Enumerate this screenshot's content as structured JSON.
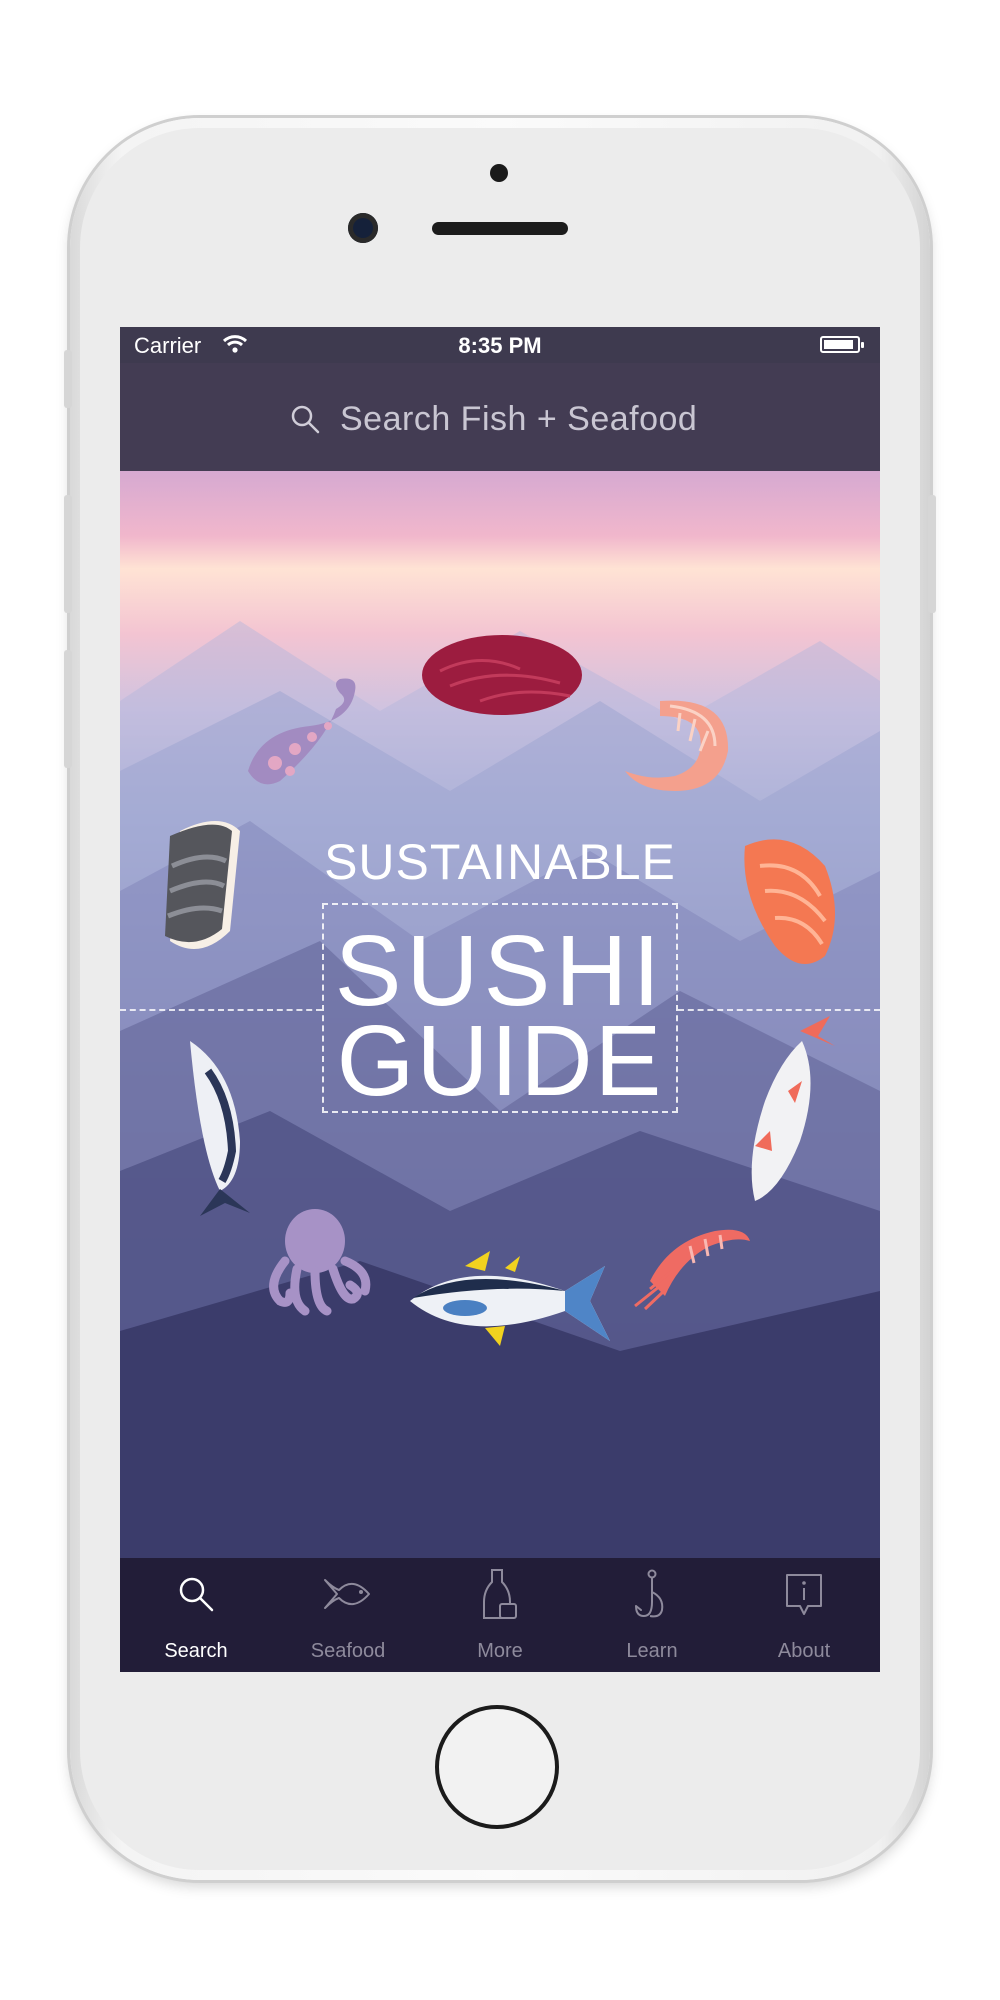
{
  "status_bar": {
    "carrier": "Carrier",
    "time": "8:35 PM"
  },
  "search": {
    "placeholder": "Search Fish + Seafood",
    "icon": "search-icon"
  },
  "hero": {
    "title_line1": "SUSTAINABLE",
    "title_line2": "SUSHI",
    "title_line3": "GUIDE",
    "illustrations": [
      "tuna-sashimi",
      "shrimp",
      "salmon-nigiri",
      "whole-fish",
      "sweet-shrimp",
      "yellowfin-tuna",
      "octopus",
      "mackerel",
      "mackerel-nigiri",
      "octopus-tentacle"
    ]
  },
  "tab_bar": {
    "tabs": [
      {
        "label": "Search",
        "icon": "search-icon",
        "active": true
      },
      {
        "label": "Seafood",
        "icon": "fish-icon",
        "active": false
      },
      {
        "label": "More",
        "icon": "sake-icon",
        "active": false
      },
      {
        "label": "Learn",
        "icon": "hook-icon",
        "active": false
      },
      {
        "label": "About",
        "icon": "info-icon",
        "active": false
      }
    ]
  },
  "colors": {
    "nav_bg": "#433c53",
    "tab_bg": "#221d38",
    "active_tab": "#ffffff",
    "inactive_tab": "#8e8a9c"
  }
}
